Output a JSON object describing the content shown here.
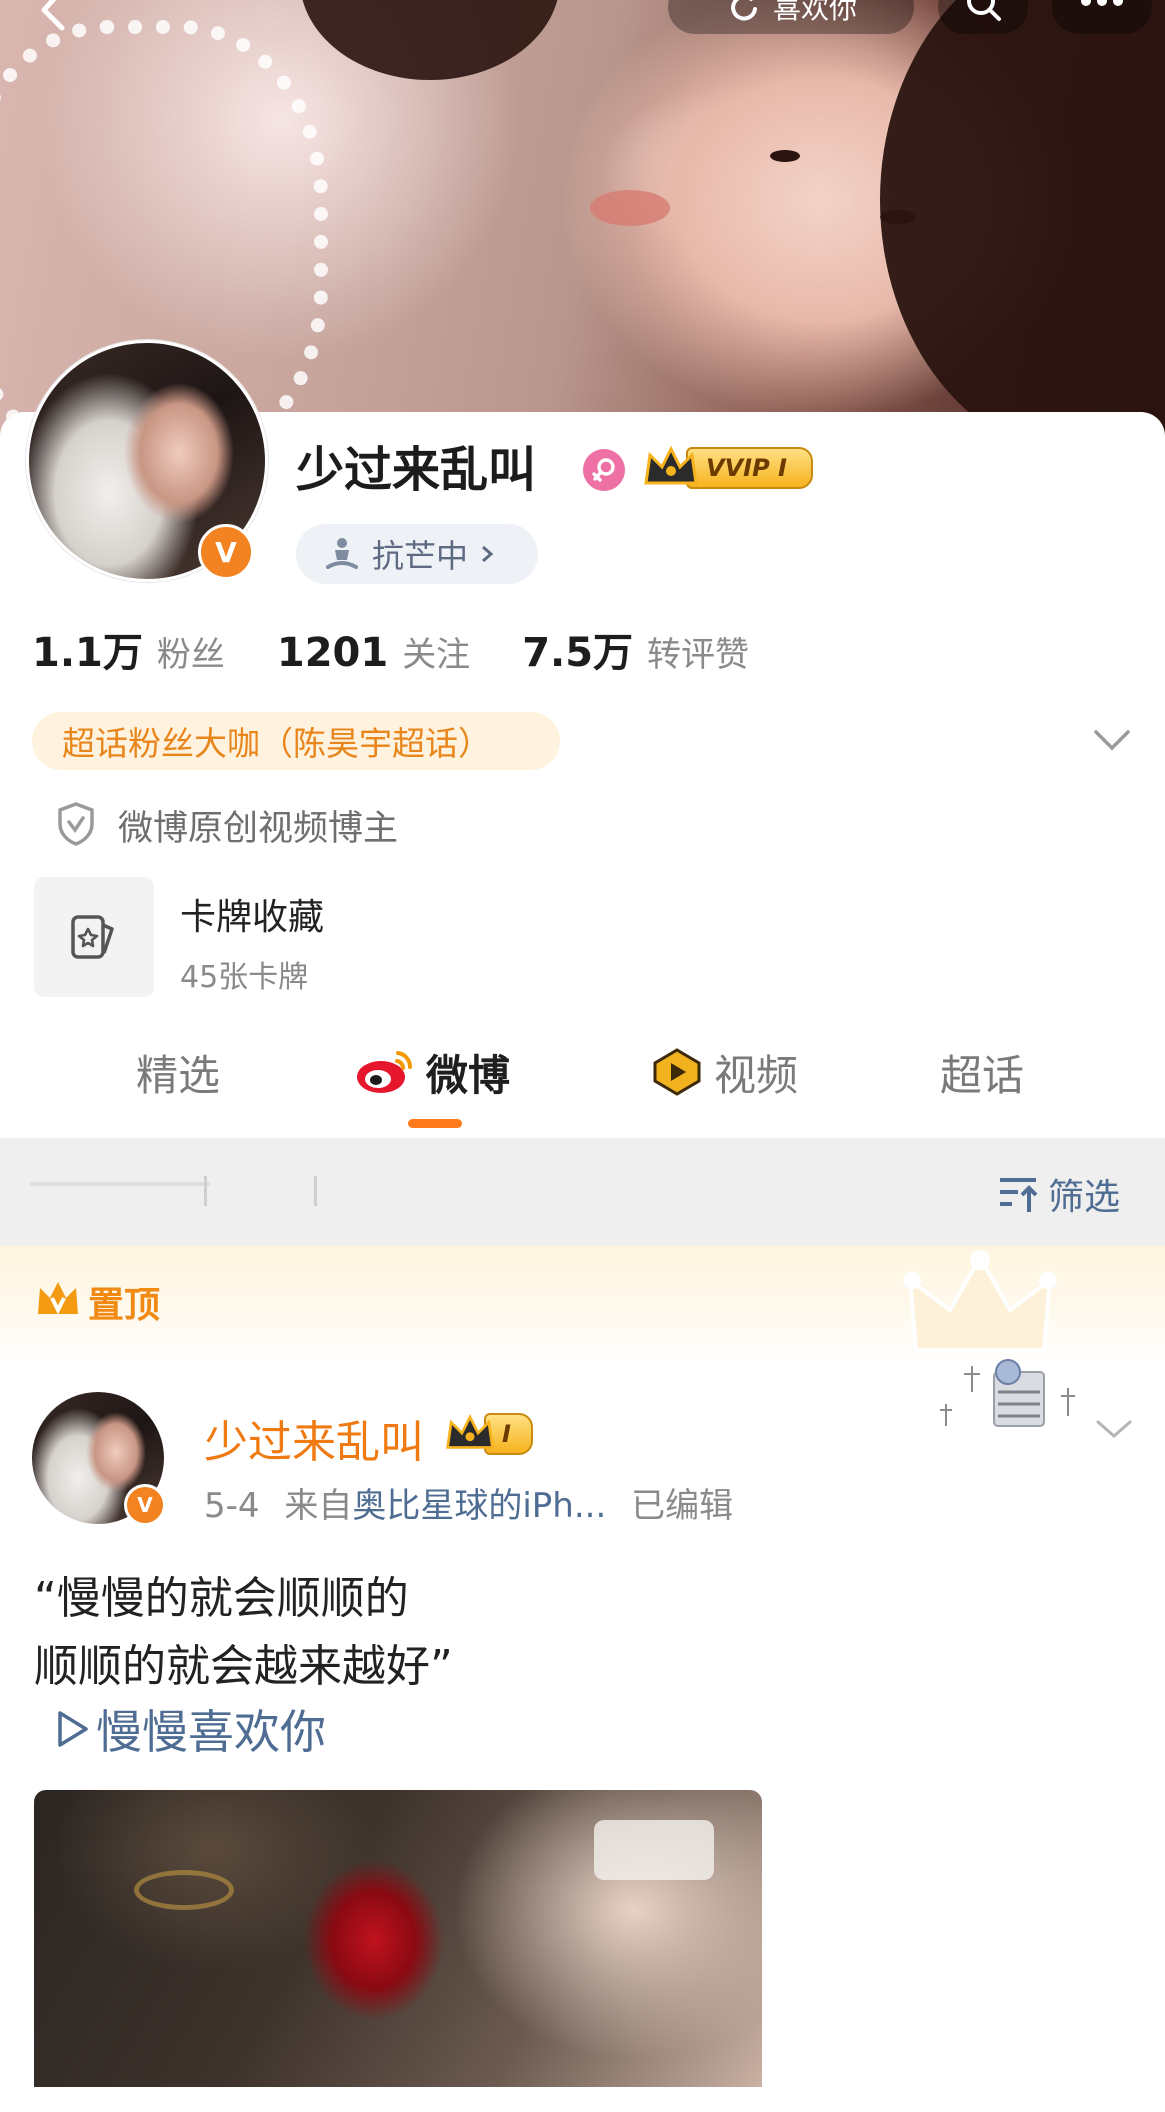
{
  "header": {
    "like_button_label": "喜欢你"
  },
  "profile": {
    "nickname": "少过来乱叫",
    "vip_label": "VVIP I",
    "status_chip": "抗芒中",
    "stats": [
      {
        "value": "1.1万",
        "label": "粉丝"
      },
      {
        "value": "1201",
        "label": "关注"
      },
      {
        "value": "7.5万",
        "label": "转评赞"
      }
    ],
    "fan_badge": "超话粉丝大咖（陈昊宇超话）",
    "verification": "微博原创视频博主",
    "card_collection": {
      "title": "卡牌收藏",
      "subtitle": "45张卡牌"
    }
  },
  "tabs": [
    {
      "label": "精选",
      "active": false
    },
    {
      "label": "微博",
      "active": true
    },
    {
      "label": "视频",
      "active": false
    },
    {
      "label": "超话",
      "active": false
    }
  ],
  "filter": {
    "label": "筛选"
  },
  "pinned": {
    "label": "置顶"
  },
  "post": {
    "author": "少过来乱叫",
    "vip_label": "I",
    "date": "5-4",
    "source_prefix": "来自",
    "source": "奥比星球的iPh...",
    "edited": "已编辑",
    "text_lines": [
      "“慢慢的就会顺顺的",
      "顺顺的就会越来越好”"
    ],
    "link_text": "慢慢喜欢你"
  },
  "colors": {
    "accent_orange": "#ff7a1a",
    "link_blue": "#4f6d93",
    "vip_gold": "#f6b31e",
    "verified_orange": "#f38321"
  }
}
